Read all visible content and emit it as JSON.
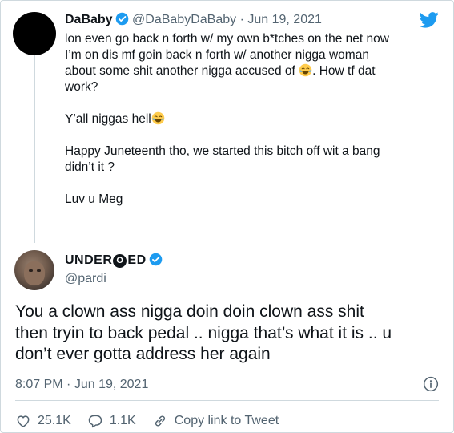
{
  "tweet1": {
    "display_name": "DaBaby",
    "handle": "@DaBabyDaBaby",
    "separator": "·",
    "date": "Jun 19, 2021",
    "lines": [
      "lon even go back n forth w/ my own b*tches on the net now",
      "I’m on dis mf goin back n forth w/ another nigga woman",
      "about some shit another nigga accused of",
      ". How tf dat",
      "work?",
      "Y’all niggas hell",
      "Happy Juneteenth tho, we started this bitch off wit a bang",
      "didn’t it ?",
      "Luv u Meg"
    ]
  },
  "tweet2": {
    "name_part1": "UNDER",
    "name_badge": "O",
    "name_part2": "ED",
    "handle": "@pardi",
    "lines": [
      "You a clown ass nigga doin  doin clown ass shit",
      "then tryin to back pedal .. nigga that’s what it is .. u",
      "don’t ever gotta address her again"
    ],
    "time": "8:07 PM",
    "separator": "·",
    "date": "Jun 19, 2021"
  },
  "actions": {
    "likes": "25.1K",
    "replies": "1.1K",
    "copy_link": "Copy link to Tweet"
  },
  "icons": {
    "twitter": "twitter-bird-icon",
    "verified": "verified-badge-icon",
    "emoji": "laughing-tears-emoji",
    "info": "info-icon",
    "like": "heart-icon",
    "reply": "reply-bubble-icon",
    "link": "link-icon"
  },
  "colors": {
    "twitter_blue": "#1d9bf0",
    "text": "#0f1419",
    "secondary": "#536471"
  }
}
